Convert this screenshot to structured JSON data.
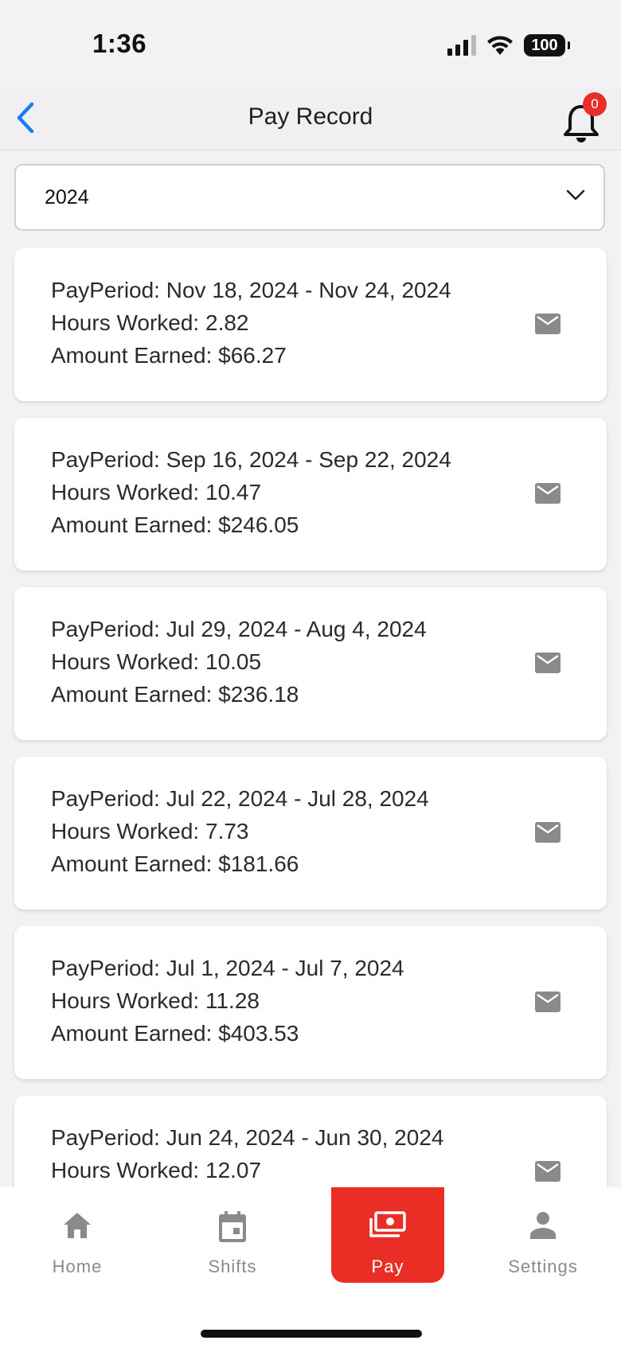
{
  "status_bar": {
    "time": "1:36",
    "battery": "100"
  },
  "header": {
    "title": "Pay Record",
    "notification_count": "0"
  },
  "year_select": {
    "selected": "2024"
  },
  "pay_records": [
    {
      "period": "PayPeriod: Nov 18, 2024 - Nov 24, 2024",
      "hours": "Hours Worked: 2.82",
      "amount": "Amount Earned: $66.27"
    },
    {
      "period": "PayPeriod: Sep 16, 2024 - Sep 22, 2024",
      "hours": "Hours Worked: 10.47",
      "amount": "Amount Earned: $246.05"
    },
    {
      "period": "PayPeriod: Jul 29, 2024 - Aug 4, 2024",
      "hours": "Hours Worked: 10.05",
      "amount": "Amount Earned: $236.18"
    },
    {
      "period": "PayPeriod: Jul 22, 2024 - Jul 28, 2024",
      "hours": "Hours Worked: 7.73",
      "amount": "Amount Earned: $181.66"
    },
    {
      "period": "PayPeriod: Jul 1, 2024 - Jul 7, 2024",
      "hours": "Hours Worked: 11.28",
      "amount": "Amount Earned: $403.53"
    },
    {
      "period": "PayPeriod: Jun 24, 2024 - Jun 30, 2024",
      "hours": "Hours Worked: 12.07",
      "amount": ""
    }
  ],
  "tabs": [
    {
      "label": "Home",
      "icon": "home-icon"
    },
    {
      "label": "Shifts",
      "icon": "calendar-icon"
    },
    {
      "label": "Pay",
      "icon": "money-icon",
      "active": true
    },
    {
      "label": "Settings",
      "icon": "person-icon"
    }
  ],
  "colors": {
    "accent": "#ea2e26",
    "back_arrow": "#1a7cf0",
    "icon_gray": "#8a8a8a"
  }
}
